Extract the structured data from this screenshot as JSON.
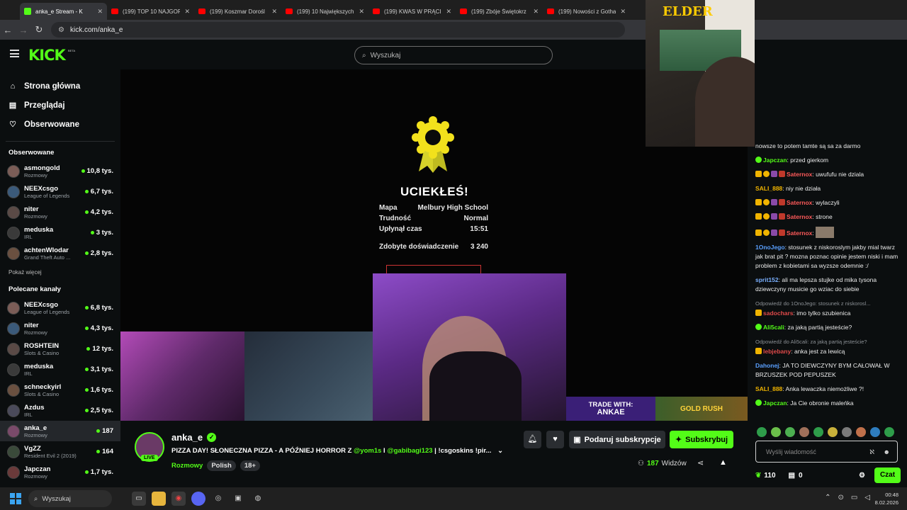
{
  "browser": {
    "tabs": [
      {
        "label": "anka_e Stream - K",
        "active": true
      },
      {
        "label": "(199) TOP 10 NAJGORS"
      },
      {
        "label": "(199) Koszmar Dorośl"
      },
      {
        "label": "(199) 10 Największych"
      },
      {
        "label": "(199) KWAS W PRĄCI"
      },
      {
        "label": "(199) Zbóje Świętokrz"
      },
      {
        "label": "(199) Nowości z Gotha"
      }
    ],
    "url": "kick.com/anka_e"
  },
  "header": {
    "logo": "KICK",
    "beta": "BETA",
    "search_placeholder": "Wyszukaj"
  },
  "sidebar": {
    "nav": [
      {
        "label": "Strona główna",
        "icon": "home-icon"
      },
      {
        "label": "Przeglądaj",
        "icon": "browse-icon"
      },
      {
        "label": "Obserwowane",
        "icon": "heart-icon"
      }
    ],
    "followed_title": "Obserwowane",
    "followed": [
      {
        "name": "asmongold",
        "category": "Rozmowy",
        "viewers": "10,8 tys."
      },
      {
        "name": "NEEXcsgo",
        "category": "League of Legends",
        "viewers": "6,7 tys."
      },
      {
        "name": "niter",
        "category": "Rozmowy",
        "viewers": "4,2 tys."
      },
      {
        "name": "meduska",
        "category": "IRL",
        "viewers": "3 tys."
      },
      {
        "name": "achtenWlodar",
        "category": "Grand Theft Auto ...",
        "viewers": "2,8 tys."
      }
    ],
    "show_more": "Pokaż więcej",
    "recommended_title": "Polecane kanały",
    "recommended": [
      {
        "name": "NEEXcsgo",
        "category": "League of Legends",
        "viewers": "6,8 tys."
      },
      {
        "name": "niter",
        "category": "Rozmowy",
        "viewers": "4,3 tys."
      },
      {
        "name": "ROSHTEIN",
        "category": "Slots & Casino",
        "viewers": "12 tys."
      },
      {
        "name": "meduska",
        "category": "IRL",
        "viewers": "3,1 tys."
      },
      {
        "name": "schneckyirl",
        "category": "Slots & Casino",
        "viewers": "1,6 tys."
      },
      {
        "name": "Azdus",
        "category": "IRL",
        "viewers": "2,5 tys."
      },
      {
        "name": "anka_e",
        "category": "Rozmowy",
        "viewers": "187",
        "selected": true
      },
      {
        "name": "VgZZ",
        "category": "Resident Evil 2 (2019)",
        "viewers": "164"
      },
      {
        "name": "Japczan",
        "category": "Rozmowy",
        "viewers": "1,7 tys."
      }
    ]
  },
  "player": {
    "game_over_title": "UCIEKŁEŚ!",
    "stats": [
      {
        "label": "Mapa",
        "value": "Melbury High School"
      },
      {
        "label": "Trudność",
        "value": "Normal"
      },
      {
        "label": "Upłynął czas",
        "value": "15:51"
      }
    ],
    "xp_label": "Zdobyte doświadczenie",
    "xp_value": "3 240",
    "banner_line1": "TRADE WITH:",
    "banner_line2": "ANKAE",
    "banner2": "GOLD RUSH"
  },
  "stream_info": {
    "streamer": "anka_e",
    "live": "LIVE",
    "title_prefix": "PIZZA DAY! SŁONECZNA PIZZA - A PÓŹNIEJ HORROR Z ",
    "mention1": "@yom1s",
    "title_mid": " I ",
    "mention2": "@gabibagi123",
    "title_suffix": " | !csgoskins !pir...",
    "category": "Rozmowy",
    "tags": [
      "Polish",
      "18+"
    ],
    "gift_sub_label": "Podaruj subskrypcje",
    "subscribe_label": "Subskrybuj",
    "viewers_count": "187",
    "viewers_label": "Widzów"
  },
  "chat": {
    "messages": [
      {
        "user": "",
        "text": "nowsze to potem tamte są sa za darmo",
        "color": "#c8c8c8"
      },
      {
        "user": "Japczan",
        "text": "przed gierkom",
        "color": "#53fc18"
      },
      {
        "user": "Saternox",
        "text": "uwufufu nie dziala",
        "color": "#ff5a5a"
      },
      {
        "user": "SALI_888",
        "text": "niy nie działa",
        "color": "#f0b400"
      },
      {
        "user": "Saternox",
        "text": "wylaczyli",
        "color": "#ff5a5a"
      },
      {
        "user": "Saternox",
        "text": "strone",
        "color": "#ff5a5a"
      },
      {
        "user": "Saternox",
        "text": "",
        "color": "#ff5a5a"
      },
      {
        "user": "1OnoJego",
        "text": "stosunek z niskoroslym jakby mial twarz jak brat pit ? mozna poznac opinie jestem niski i mam problem z kobietami sa wyzsze odemnie :/",
        "color": "#5aa0ff"
      },
      {
        "user": "sprit152",
        "text": "ali ma lepsza stujke od mika tysona dziewczyny musicie go wziac do siebie",
        "color": "#7ab0ff"
      },
      {
        "reply": "Odpowiedź do 1OnoJego: stosunek z niskorosl...",
        "user": "sadochars",
        "text": "imo tylko szubienica",
        "color": "#e04a4a"
      },
      {
        "user": "Ali5cali",
        "text": "za jaką partią jesteście?",
        "color": "#53fc18"
      },
      {
        "reply": "Odpowiedź do Ali5cali: za jaką partią jesteście?",
        "user": "lebjebany",
        "text": "anka jest za lewicą",
        "color": "#e04a4a"
      },
      {
        "user": "Dahonej",
        "text": "JA TO DIEWCZYNY BYM CAŁOWAŁ W BRZUSZEK POD PEPUSZEK",
        "color": "#5aa0ff"
      },
      {
        "user": "SALI_888",
        "text": "Anka lewaczka niemożliwe ?!",
        "color": "#f0b400"
      },
      {
        "user": "Japczan",
        "text": "Ja Cie obronie maleńka",
        "color": "#53fc18"
      }
    ],
    "input_placeholder": "Wyślij wiadomość",
    "points": "110",
    "gifts": "0",
    "send_label": "Czat"
  },
  "overlay": {
    "sign": "ELDER"
  },
  "taskbar": {
    "search": "Wyszukaj",
    "time": "00:48",
    "date": "8.02.2026"
  }
}
